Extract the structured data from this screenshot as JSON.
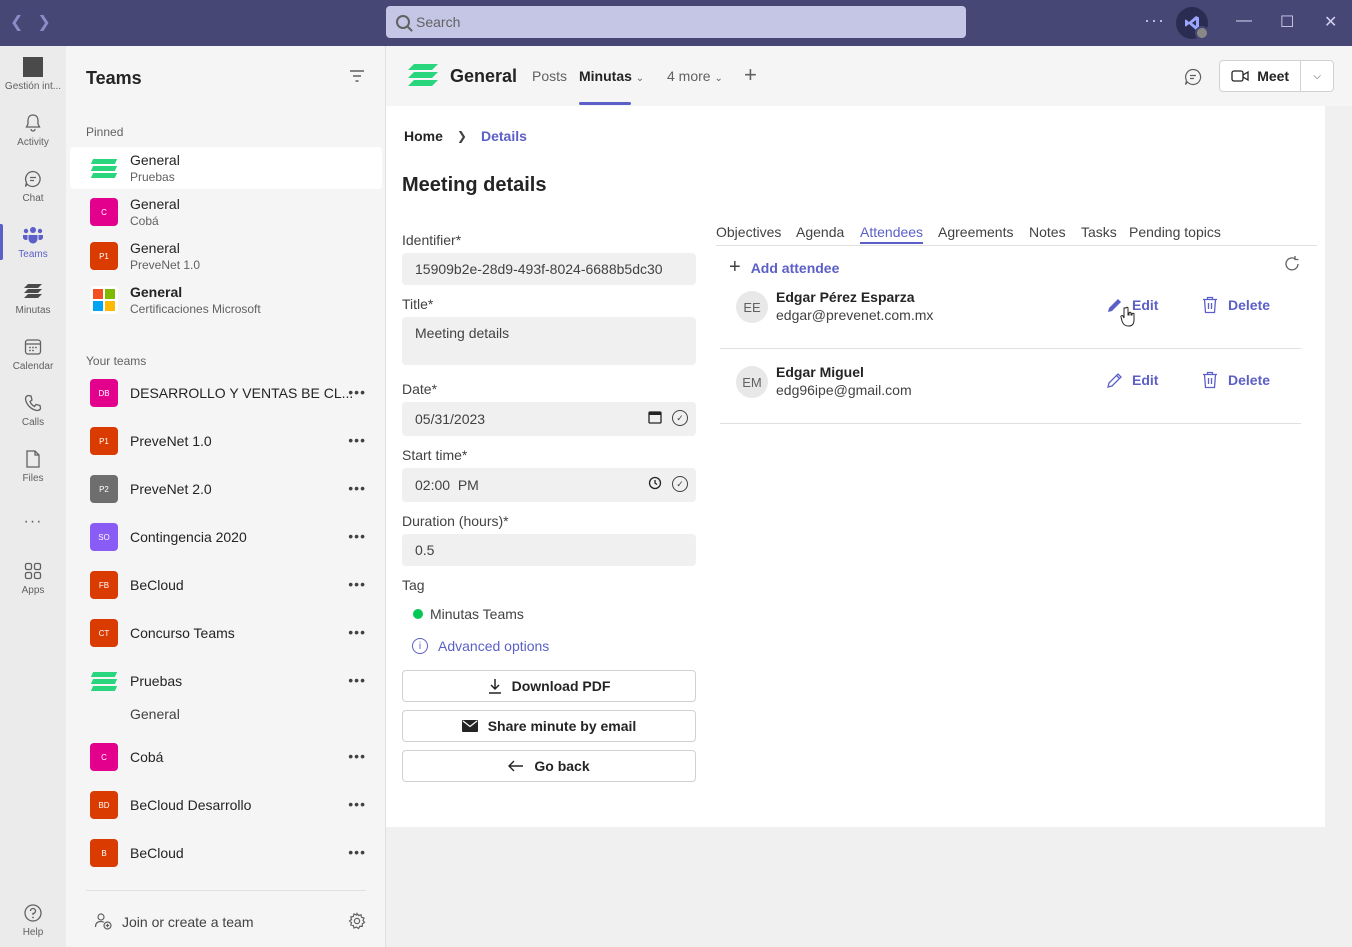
{
  "titlebar": {
    "search_placeholder": "Search",
    "more": "···"
  },
  "rail": {
    "items": [
      {
        "label": "Gestión int...",
        "icon": "app-icon"
      },
      {
        "label": "Activity",
        "icon": "bell-icon"
      },
      {
        "label": "Chat",
        "icon": "chat-icon"
      },
      {
        "label": "Teams",
        "icon": "teams-icon",
        "active": true
      },
      {
        "label": "Minutas",
        "icon": "minutas-icon"
      },
      {
        "label": "Calendar",
        "icon": "calendar-icon"
      },
      {
        "label": "Calls",
        "icon": "phone-icon"
      },
      {
        "label": "Files",
        "icon": "file-icon"
      },
      {
        "label": "···",
        "icon": "more-icon"
      },
      {
        "label": "Apps",
        "icon": "apps-icon"
      },
      {
        "label": "Help",
        "icon": "help-icon"
      }
    ]
  },
  "panel": {
    "title": "Teams",
    "pinned_label": "Pinned",
    "pinned": [
      {
        "name": "General",
        "sub": "Pruebas",
        "icon": "stack",
        "color": "#29d67e"
      },
      {
        "name": "General",
        "sub": "Cobá",
        "initials": "C",
        "color": "#e3008c"
      },
      {
        "name": "General",
        "sub": "PreveNet 1.0",
        "initials": "P1",
        "color": "#da3b01"
      },
      {
        "name": "General",
        "sub": "Certificaciones Microsoft",
        "icon": "ms"
      }
    ],
    "your_teams_label": "Your teams",
    "teams": [
      {
        "name": "DESARROLLO Y VENTAS BE CL...",
        "initials": "DB",
        "color": "#e3008c"
      },
      {
        "name": "PreveNet 1.0",
        "initials": "P1",
        "color": "#da3b01"
      },
      {
        "name": "PreveNet 2.0",
        "initials": "P2",
        "color": "#6e6e6e"
      },
      {
        "name": "Contingencia 2020",
        "initials": "SO",
        "color": "#8a5cf6"
      },
      {
        "name": "BeCloud",
        "initials": "FB",
        "color": "#da3b01"
      },
      {
        "name": "Concurso Teams",
        "initials": "CT",
        "color": "#da3b01"
      },
      {
        "name": "Pruebas",
        "icon": "stack",
        "color": "#29d67e"
      },
      {
        "name": "Cobá",
        "initials": "C",
        "color": "#e3008c"
      },
      {
        "name": "BeCloud Desarrollo",
        "initials": "BD",
        "color": "#da3b01"
      },
      {
        "name": "BeCloud",
        "initials": "B",
        "color": "#da3b01"
      }
    ],
    "pruebas_channel": "General",
    "join_label": "Join or create a team"
  },
  "header": {
    "channel": "General",
    "tabs": [
      "Posts",
      "Minutas",
      "4 more"
    ],
    "meet_label": "Meet"
  },
  "content": {
    "breadcrumb": {
      "home": "Home",
      "current": "Details"
    },
    "title": "Meeting details",
    "form": {
      "identifier_label": "Identifier*",
      "identifier": "15909b2e-28d9-493f-8024-6688b5dc30",
      "title_label": "Title*",
      "title_value": "Meeting details",
      "date_label": "Date*",
      "date_value": "05/31/2023",
      "start_label": "Start time*",
      "start_value": "02:00  PM",
      "duration_label": "Duration (hours)*",
      "duration_value": "0.5",
      "tag_label": "Tag",
      "tag_value": "Minutas Teams",
      "advanced": "Advanced options"
    },
    "buttons": {
      "download": "Download PDF",
      "share": "Share minute by email",
      "back": "Go back"
    },
    "tabs": [
      "Objectives",
      "Agenda",
      "Attendees",
      "Agreements",
      "Notes",
      "Tasks",
      "Pending topics"
    ],
    "add_attendee": "Add attendee",
    "attendees": [
      {
        "initials": "EE",
        "name": "Edgar Pérez Esparza",
        "email": "edgar@prevenet.com.mx"
      },
      {
        "initials": "EM",
        "name": "Edgar Miguel",
        "email": "edg96ipe@gmail.com"
      }
    ],
    "edit_label": "Edit",
    "delete_label": "Delete"
  },
  "colors": {
    "brand": "#5b5fc7",
    "titlebar": "#464775",
    "tag_green": "#00c853"
  }
}
